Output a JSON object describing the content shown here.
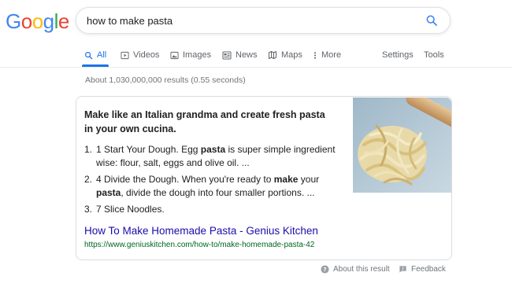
{
  "logo": {
    "letters": [
      "G",
      "o",
      "o",
      "g",
      "l",
      "e"
    ],
    "colors": [
      "#4285F4",
      "#EA4335",
      "#FBBC05",
      "#4285F4",
      "#34A853",
      "#EA4335"
    ]
  },
  "search": {
    "query": "how to make pasta",
    "icon": "search-icon"
  },
  "tabs": [
    {
      "label": "All",
      "icon": "search-icon",
      "active": true
    },
    {
      "label": "Videos",
      "icon": "video-icon"
    },
    {
      "label": "Images",
      "icon": "image-icon"
    },
    {
      "label": "News",
      "icon": "news-icon"
    },
    {
      "label": "Maps",
      "icon": "map-icon"
    },
    {
      "label": "More",
      "icon": "more-vertical-icon"
    }
  ],
  "tools": {
    "settings": "Settings",
    "tools": "Tools"
  },
  "result_stats": "About 1,030,000,000 results (0.55 seconds)",
  "snippet": {
    "heading": "Make like an Italian grandma and create fresh pasta in your own cucina.",
    "steps": [
      {
        "num": "1.",
        "parts": [
          {
            "t": "1 Start Your Dough. Egg ",
            "b": false
          },
          {
            "t": "pasta",
            "b": true
          },
          {
            "t": " is super simple ingredient wise: flour, salt, eggs and olive oil. ...",
            "b": false
          }
        ]
      },
      {
        "num": "2.",
        "parts": [
          {
            "t": "4 Divide the Dough. When you're ready to ",
            "b": false
          },
          {
            "t": "make",
            "b": true
          },
          {
            "t": " your ",
            "b": false
          },
          {
            "t": "pasta",
            "b": true
          },
          {
            "t": ", divide the dough into four smaller portions. ...",
            "b": false
          }
        ]
      },
      {
        "num": "3.",
        "parts": [
          {
            "t": "7 Slice Noodles.",
            "b": false
          }
        ]
      }
    ],
    "title": "How To Make Homemade Pasta - Genius Kitchen",
    "url": "https://www.geniuskitchen.com/how-to/make-homemade-pasta-42"
  },
  "footer": {
    "about": "About this result",
    "feedback": "Feedback"
  },
  "colors": {
    "link": "#1a0dab",
    "url": "#006621",
    "accent": "#1a73e8"
  }
}
